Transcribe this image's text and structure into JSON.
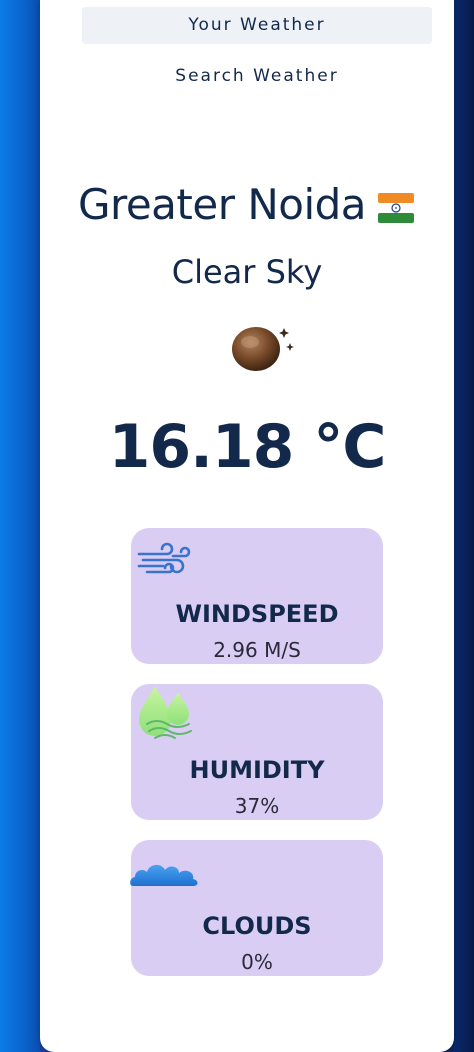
{
  "nav": {
    "tabs": [
      {
        "label": "Your Weather",
        "active": true
      },
      {
        "label": "Search Weather",
        "active": false
      }
    ]
  },
  "weather": {
    "city": "Greater Noida",
    "country_flag": "india-flag-icon",
    "description": "Clear Sky",
    "condition_icon": "clear-night-icon",
    "temperature": "16.18 °C"
  },
  "stats": [
    {
      "label": "WINDSPEED",
      "value": "2.96 M/S",
      "icon": "wind-icon"
    },
    {
      "label": "HUMIDITY",
      "value": "37%",
      "icon": "humidity-drops-icon"
    },
    {
      "label": "CLOUDS",
      "value": "0%",
      "icon": "cloud-icon"
    }
  ],
  "colors": {
    "text_primary": "#13294b",
    "stat_card_bg": "#d9cdf4",
    "tab_active_bg": "#eef2f7",
    "background_left": "#0a6fd8",
    "background_right": "#081a4c"
  }
}
